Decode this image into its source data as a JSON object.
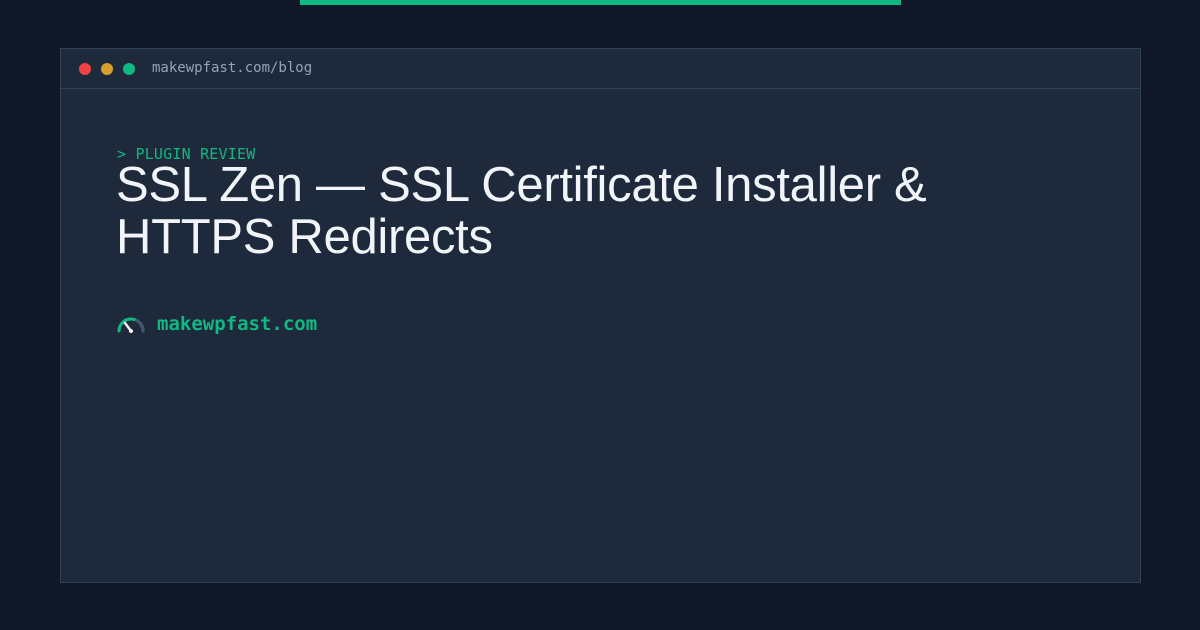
{
  "browser": {
    "url": "makewpfast.com/blog"
  },
  "post": {
    "eyebrow": "> PLUGIN REVIEW",
    "title": "SSL Zen — SSL Certificate Installer & HTTPS Redirects"
  },
  "brand": {
    "name": "makewpfast.com",
    "logo_icon": "speedometer-icon"
  },
  "colors": {
    "background": "#0f1729",
    "window": "#1e293b",
    "accent": "#10b981",
    "title_text": "#f1f5f9",
    "muted_text": "#94a3b8"
  }
}
